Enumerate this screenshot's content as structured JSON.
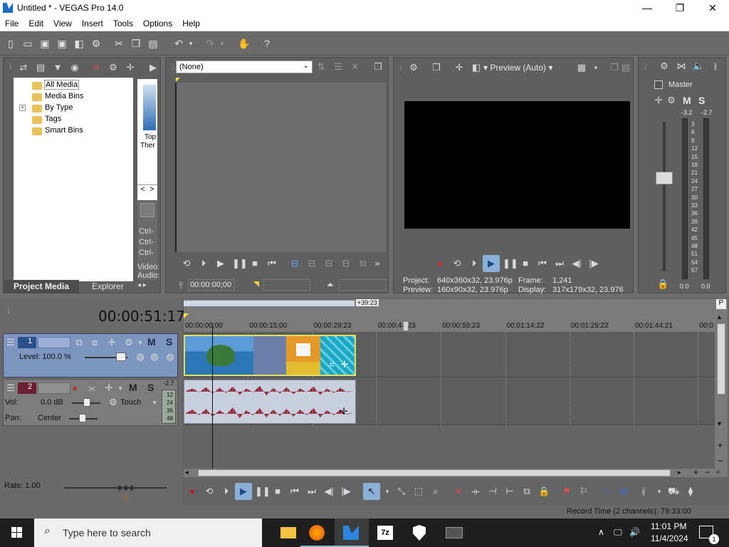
{
  "window": {
    "title": "Untitled * - VEGAS Pro 14.0",
    "minimize": "—",
    "maximize": "❐",
    "close": "✕"
  },
  "menu": [
    "File",
    "Edit",
    "View",
    "Insert",
    "Tools",
    "Options",
    "Help"
  ],
  "project_media": {
    "tree": [
      "All Media",
      "Media Bins",
      "By Type",
      "Tags",
      "Smart Bins"
    ],
    "expander": "+",
    "thumb_caption_1": "Top",
    "thumb_caption_2": "Ther",
    "shortcut_labels": [
      "Ctrl-",
      "Ctrl-",
      "Ctrl-"
    ],
    "side_labels": [
      "Video:",
      "Audio:"
    ],
    "tabs": [
      "Project Media",
      "Explorer"
    ],
    "nav_left": "<",
    "nav_right": ">"
  },
  "trimmer": {
    "select_value": "(None)",
    "timecode": "00:00:00;00"
  },
  "preview": {
    "mode": "Preview (Auto)",
    "project_label": "Project:",
    "project_value": "640x360x32, 23.976p",
    "preview_label": "Preview:",
    "preview_value": "160x90x32, 23.976p",
    "frame_label": "Frame:",
    "frame_value": "1,241",
    "display_label": "Display:",
    "display_value": "317x179x32, 23.976"
  },
  "master": {
    "title": "Master",
    "m": "M",
    "s": "S",
    "peak_left": "-3.2",
    "peak_right": "-2.7",
    "scale": [
      "3",
      "6",
      "9",
      "12",
      "15",
      "18",
      "21",
      "24",
      "27",
      "30",
      "33",
      "36",
      "39",
      "42",
      "45",
      "48",
      "51",
      "54",
      "57"
    ],
    "bottom_left": "0.0",
    "bottom_right": "0.0"
  },
  "timeline": {
    "cursor_time": "00:00:51:17",
    "length_badge": "+39:23",
    "ruler_ticks": [
      "00:00:00;00",
      "00:00:15:00",
      "00:00:29:23",
      "00:00:44:23",
      "00:00:59:23",
      "00:01:14:22",
      "00:01:29:22",
      "00:01:44:21",
      "00:0"
    ],
    "video_track": {
      "number": "1",
      "level_label": "Level: 100.0 %",
      "m": "M",
      "s": "S"
    },
    "audio_track": {
      "number": "2",
      "vol_label": "Vol:",
      "vol_value": "0.0 dB",
      "pan_label": "Pan:",
      "pan_value": "Center",
      "automation": "Touch",
      "m": "M",
      "s": "S",
      "meter_top": "-2.7",
      "meter_values": [
        "12",
        "24",
        "36",
        "48"
      ]
    },
    "rate": "Rate: 1.00"
  },
  "status": {
    "record_time": "Record Time (2 channels): 79:33:00"
  },
  "taskbar": {
    "search_placeholder": "Type here to search",
    "time": "11:01 PM",
    "date": "11/4/2024",
    "notification_count": "1"
  },
  "colors": {
    "video_clip_border": "#e0e060",
    "audio_wave": "#8a2a3a",
    "track_header_video": "#7c96c0",
    "track_header_audio": "#7c7c7c"
  }
}
